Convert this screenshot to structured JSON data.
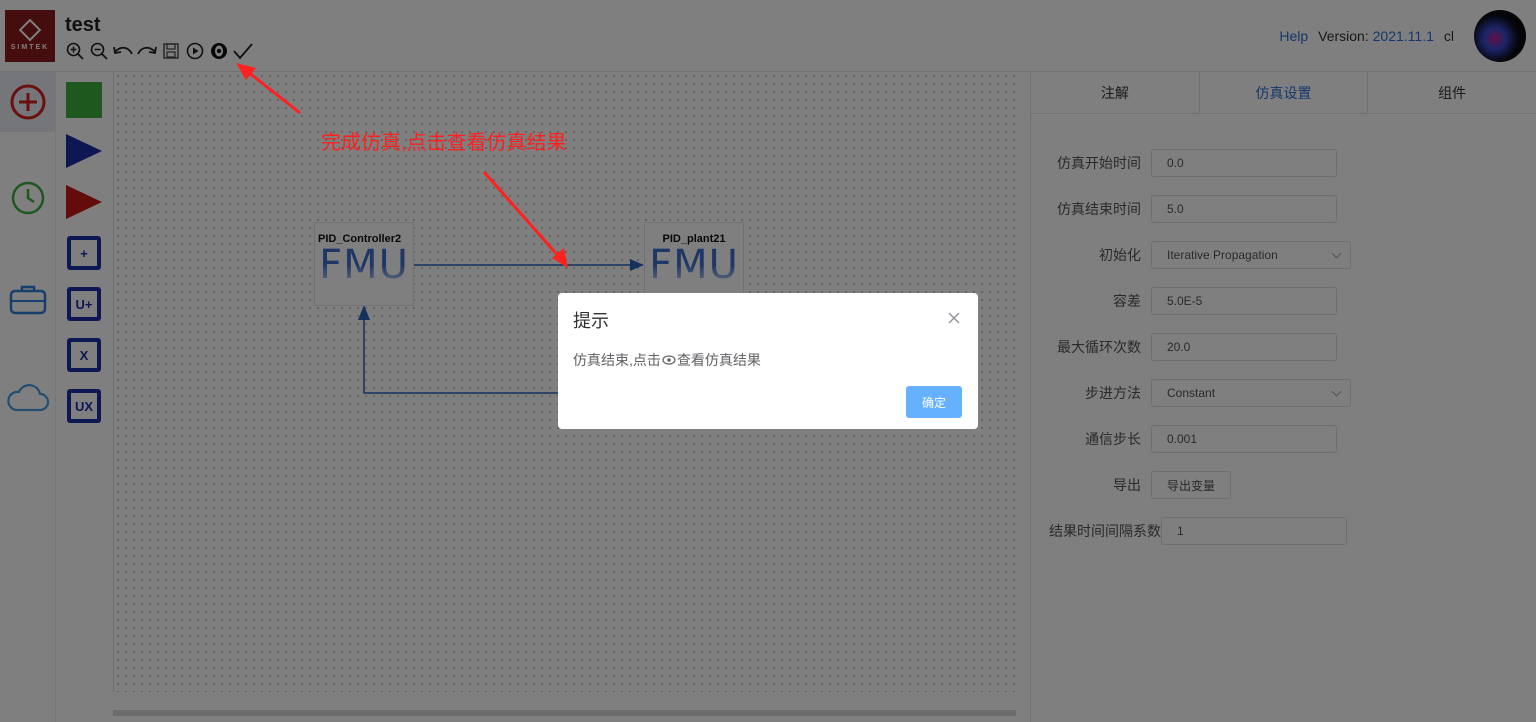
{
  "header": {
    "logo_text": "SIMTEK",
    "title": "test",
    "help_label": "Help",
    "version_label": "Version:",
    "version_value": "2021.11.1",
    "user": "cl"
  },
  "toolbar": {
    "icons": [
      "zoom-in-icon",
      "zoom-out-icon",
      "undo-icon",
      "redo-icon",
      "save-icon",
      "run-icon",
      "view-results-icon",
      "check-icon"
    ]
  },
  "palette": {
    "items": [
      "green-block",
      "blue-triangle",
      "red-triangle",
      "+",
      "U+",
      "X",
      "UX"
    ]
  },
  "canvas": {
    "blocks": [
      {
        "name": "PID_Controller2",
        "label": "FMU"
      },
      {
        "name": "PID_plant21",
        "label": "FMU"
      }
    ]
  },
  "right_panel": {
    "tabs": [
      "注解",
      "仿真设置",
      "组件"
    ],
    "active_tab": "仿真设置",
    "fields": {
      "start_time": {
        "label": "仿真开始时间",
        "value": "0.0"
      },
      "end_time": {
        "label": "仿真结束时间",
        "value": "5.0"
      },
      "init": {
        "label": "初始化",
        "value": "Iterative Propagation"
      },
      "tolerance": {
        "label": "容差",
        "value": "5.0E-5"
      },
      "max_loops": {
        "label": "最大循环次数",
        "value": "20.0"
      },
      "step_method": {
        "label": "步进方法",
        "value": "Constant"
      },
      "comm_step": {
        "label": "通信步长",
        "value": "0.001"
      },
      "export": {
        "label": "导出",
        "button": "导出变量"
      },
      "result_interval": {
        "label": "结果时间间隔系数",
        "value": "1"
      }
    }
  },
  "annotation": {
    "text": "完成仿真,点击查看仿真结果"
  },
  "dialog": {
    "title": "提示",
    "message_before": "仿真结束,点击",
    "message_after": "查看仿真结果",
    "confirm": "确定"
  },
  "colors": {
    "accent": "#2c6fd6",
    "logo_bg": "#8b1a1a",
    "palette_blue": "#1a2ea8",
    "annotation": "#ff2020",
    "confirm_btn": "#66b1ff"
  }
}
